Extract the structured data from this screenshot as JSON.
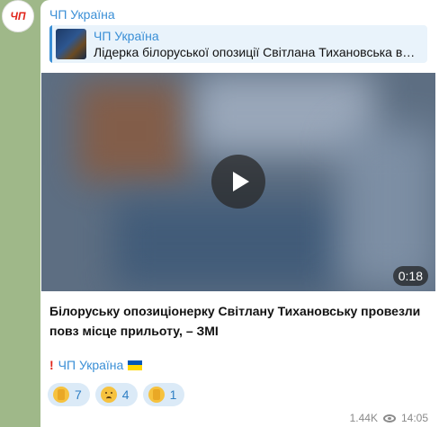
{
  "channel": {
    "avatar_text": "ЧП",
    "name": "ЧП Україна"
  },
  "reply": {
    "name": "ЧП Україна",
    "text": "Лідерка білоруської опозиції Світлана Тихановська в…"
  },
  "video": {
    "duration": "0:18"
  },
  "post": {
    "caption": "Білоруську опозиціонерку Світлану Тихановську провезли повз місце прильоту, – ЗМІ",
    "signature": "ЧП Україна"
  },
  "reactions": [
    {
      "emoji": "thumbs-down",
      "count": "7"
    },
    {
      "emoji": "sad-face",
      "count": "4"
    },
    {
      "emoji": "thumbs-up",
      "count": "1"
    }
  ],
  "meta": {
    "views": "1.44K",
    "time": "14:05"
  },
  "colors": {
    "accent": "#3a8fd6",
    "brand_red": "#e1251b",
    "chat_background": "#9fb889"
  }
}
